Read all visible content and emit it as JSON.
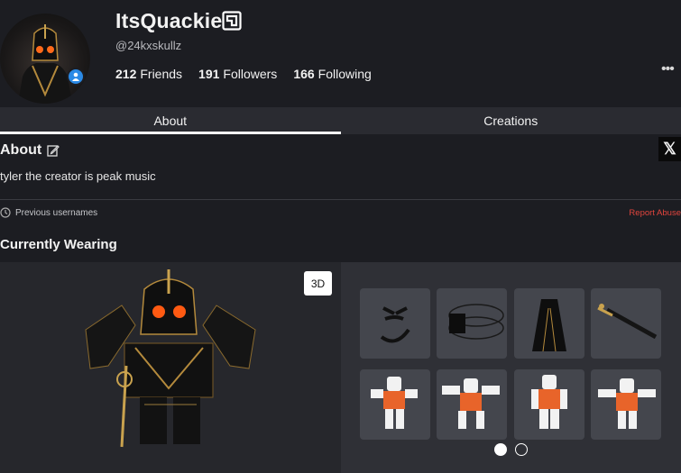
{
  "profile": {
    "display_name": "ItsQuackie",
    "username": "@24kxskullz",
    "stats": [
      {
        "count": "212",
        "label": "Friends"
      },
      {
        "count": "191",
        "label": "Followers"
      },
      {
        "count": "166",
        "label": "Following"
      }
    ]
  },
  "tabs": [
    {
      "label": "About",
      "active": true
    },
    {
      "label": "Creations",
      "active": false
    }
  ],
  "about": {
    "title": "About",
    "bio": "tyler the creator is peak music",
    "previous_usernames_label": "Previous usernames",
    "report_label": "Report Abuse"
  },
  "wearing": {
    "title": "Currently Wearing",
    "view_mode_label": "3D",
    "items": [
      {
        "icon": "face-item-icon"
      },
      {
        "icon": "neck-ring-item-icon"
      },
      {
        "icon": "cloak-item-icon"
      },
      {
        "icon": "sword-item-icon"
      },
      {
        "icon": "animation-item-icon"
      },
      {
        "icon": "animation-item-icon"
      },
      {
        "icon": "animation-item-icon"
      },
      {
        "icon": "animation-item-icon"
      }
    ],
    "pages": 2,
    "current_page": 1
  },
  "colors": {
    "background": "#1c1d22",
    "accent_report": "#e0443d",
    "badge_blue": "#2b8ae6"
  }
}
